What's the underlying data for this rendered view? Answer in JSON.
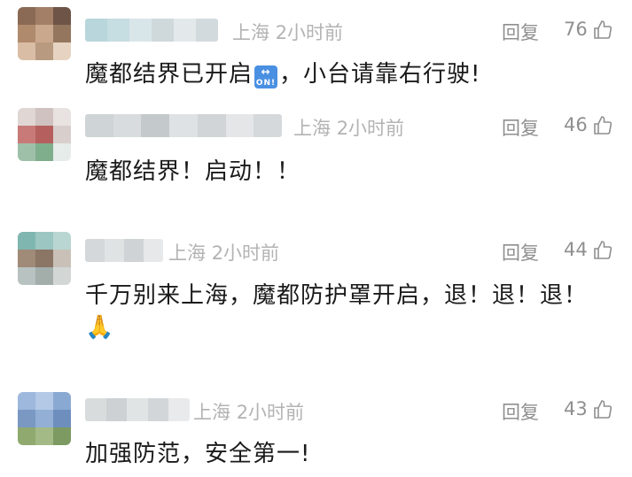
{
  "comments": [
    {
      "location": "上海",
      "time": "2小时前",
      "reply_label": "回复",
      "likes": "76",
      "text_before_badge": "魔都结界已开启",
      "badge": "ON!",
      "text_after_badge": "，小台请靠右行驶!"
    },
    {
      "location": "上海",
      "time": "2小时前",
      "reply_label": "回复",
      "likes": "46",
      "text": "魔都结界！启动！！"
    },
    {
      "location": "上海",
      "time": "2小时前",
      "reply_label": "回复",
      "likes": "44",
      "text": "千万别来上海，魔都防护罩开启，退！退！退！",
      "emoji": "🙏"
    },
    {
      "location": "上海",
      "time": "2小时前",
      "reply_label": "回复",
      "likes": "43",
      "text": "加强防范，安全第一!"
    }
  ],
  "icons": {
    "like": "thumbs-up-icon",
    "badge": "on-arrow-badge-icon",
    "emoji": "folded-hands-emoji"
  },
  "colors": {
    "meta": "#b3b3b3",
    "action": "#8f8f8f",
    "text": "#1a1a1a"
  }
}
